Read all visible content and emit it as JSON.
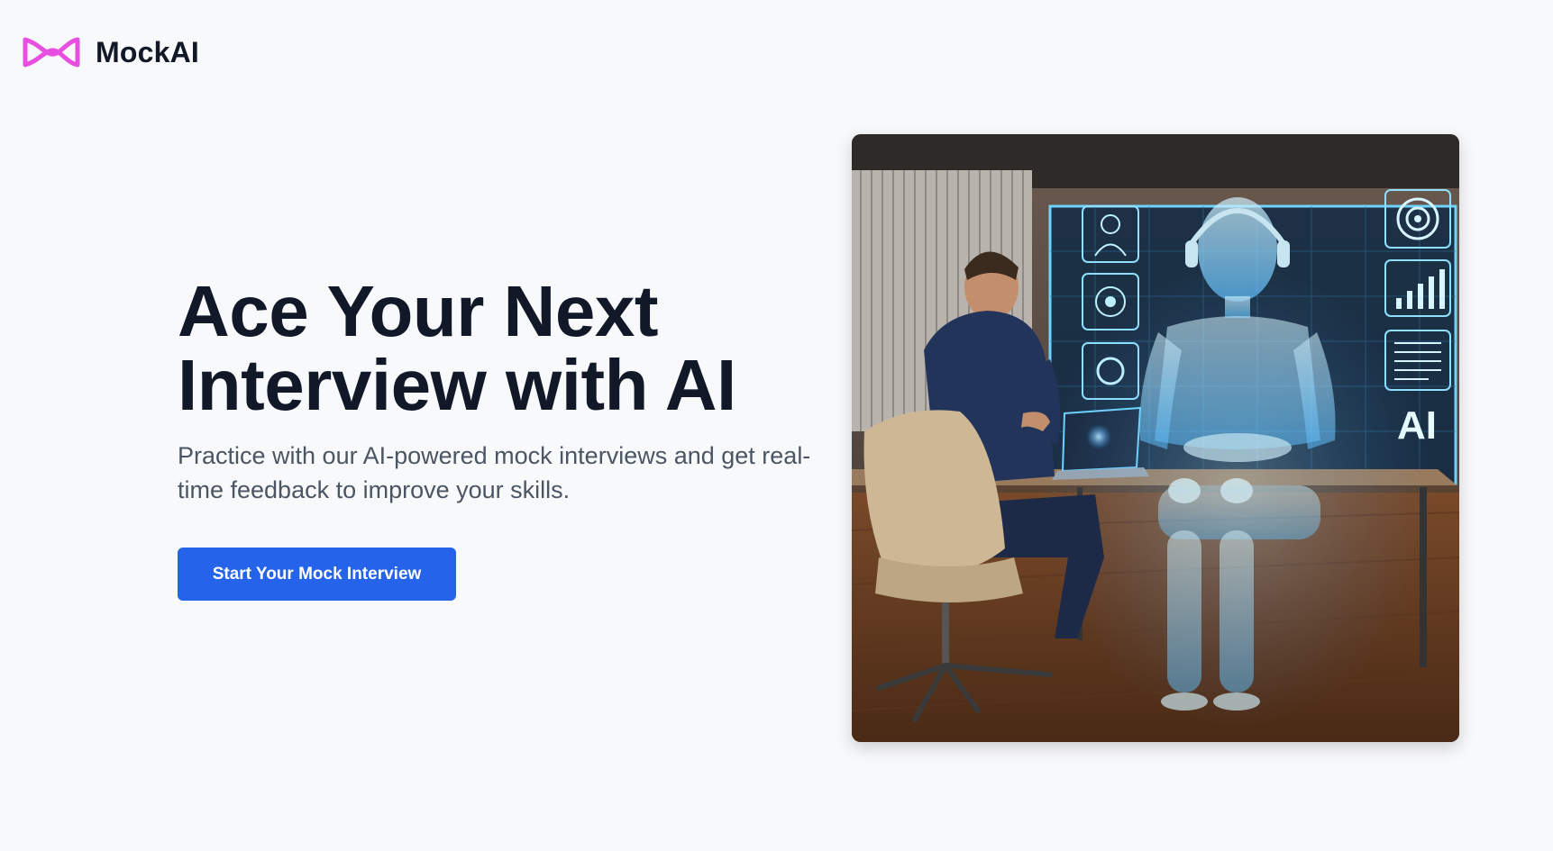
{
  "brand": {
    "name": "MockAI",
    "logo_icon": "infinity-ribbon-icon",
    "logo_color": "#e84fe0"
  },
  "hero": {
    "title_line1": "Ace Your Next",
    "title_line2": "Interview with AI",
    "subtitle": "Practice with our AI-powered mock interviews and get real-time feedback to improve your skills.",
    "cta_label": "Start Your Mock Interview",
    "image_overlay_text": "AI"
  },
  "colors": {
    "background": "#f8f9fb",
    "title": "#111827",
    "subtitle": "#4b5563",
    "cta_bg": "#2563eb",
    "cta_text": "#ffffff",
    "hologram": "#7fd8ff"
  }
}
